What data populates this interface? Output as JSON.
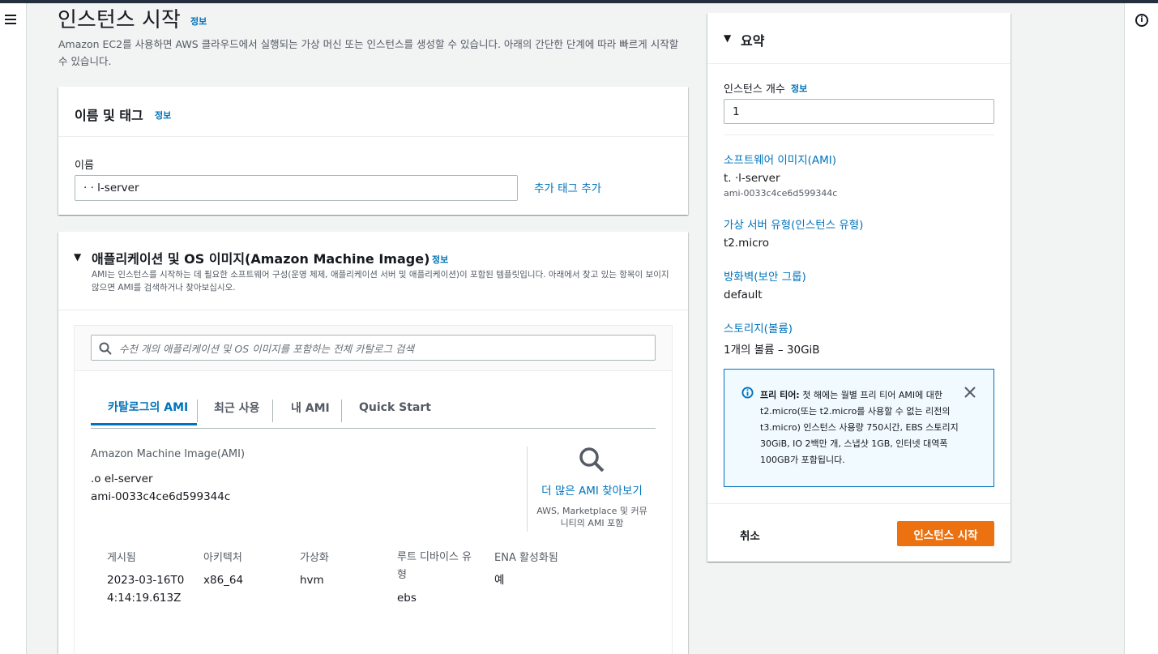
{
  "page": {
    "title": "인스턴스 시작",
    "info": "정보",
    "description": "Amazon EC2를 사용하면 AWS 클라우드에서 실행되는 가상 머신 또는 인스턴스를 생성할 수 있습니다. 아래의 간단한 단계에 따라 빠르게 시작할 수 있습니다."
  },
  "name_tags": {
    "heading": "이름 및 태그",
    "info": "정보",
    "name_label": "이름",
    "name_value": "·  ·  l-server",
    "add_tags": "추가 태그 추가"
  },
  "ami": {
    "heading": "애플리케이션 및 OS 이미지(Amazon Machine Image)",
    "info": "정보",
    "description": "AMI는 인스턴스를 시작하는 데 필요한 소프트웨어 구성(운영 체제, 애플리케이션 서버 및 애플리케이션)이 포함된 템플릿입니다. 아래에서 찾고 있는 항목이 보이지 않으면 AMI를 검색하거나 찾아보십시오.",
    "search_placeholder": "수천 개의 애플리케이션 및 OS 이미지를 포함하는 전체 카탈로그 검색",
    "tabs": [
      "카탈로그의 AMI",
      "최근 사용",
      "내 AMI",
      "Quick Start"
    ],
    "section_label": "Amazon Machine Image(AMI)",
    "ami_name": ".o  el-server",
    "ami_id": "ami-0033c4ce6d599344c",
    "browse_more": "더 많은 AMI 찾아보기",
    "browse_sub": "AWS, Marketplace 및 커뮤니티의 AMI 포함",
    "meta_headers": [
      "게시됨",
      "아키텍처",
      "가상화",
      "루트 디바이스 유형",
      "ENA 활성화됨"
    ],
    "meta_values": [
      "2023-03-16T04:14:19.613Z",
      "x86_64",
      "hvm",
      "ebs",
      "예"
    ]
  },
  "summary": {
    "heading": "요약",
    "count_label": "인스턴스 개수",
    "count_info": "정보",
    "count_value": "1",
    "ami_label": "소프트웨어 이미지(AMI)",
    "ami_name": "t.  ·l-server",
    "ami_id": "ami-0033c4ce6d599344c",
    "type_label": "가상 서버 유형(인스턴스 유형)",
    "type_value": "t2.micro",
    "firewall_label": "방화벽(보안 그룹)",
    "firewall_value": "default",
    "storage_label": "스토리지(볼륨)",
    "storage_value": "1개의 볼륨 – 30GiB",
    "free_tier_title": "프리 티어:",
    "free_tier_text": "첫 해에는 월별 프리 티어 AMI에 대한 t2.micro(또는 t2.micro를 사용할 수 없는 리전의 t3.micro) 인스턴스 사용량 750시간, EBS 스토리지 30GiB, IO 2백만 개, 스냅샷 1GB, 인터넷 대역폭 100GB가 포함됩니다.",
    "cancel": "취소",
    "launch": "인스턴스 시작"
  },
  "colors": {
    "accent": "#0073bb",
    "primary_button": "#ec7211",
    "topbar": "#232f3e"
  }
}
